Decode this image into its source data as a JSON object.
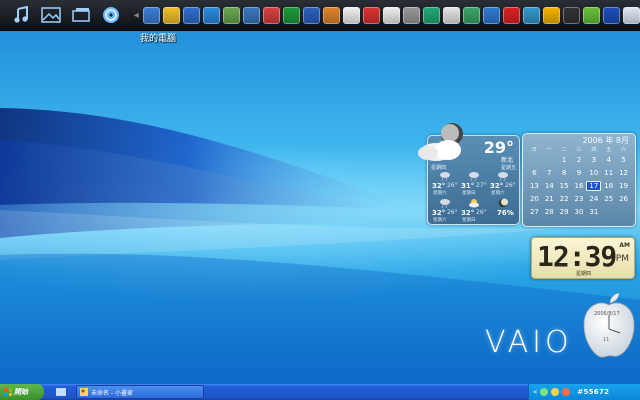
{
  "dock": {
    "label": "我的電腦",
    "big_icons": [
      "music-note-icon",
      "picture-icon",
      "window-icon",
      "disc-icon"
    ],
    "app_icon_colors": [
      "#3b7fd8",
      "#f2c02b",
      "#2f6fd0",
      "#2c8be0",
      "#6aa84f",
      "#3a78c0",
      "#d84141",
      "#1d9a3b",
      "#2c62c2",
      "#e0842c",
      "#f2f2f2",
      "#d33",
      "#efefef",
      "#999",
      "#2a7",
      "#e6e6e6",
      "#3aa66a",
      "#2e7bd6",
      "#d22",
      "#39c",
      "#f7b500",
      "#333",
      "#67c23a",
      "#1d4fbd",
      "#dfe8f5"
    ]
  },
  "weather": {
    "temp": "29°",
    "city": "新北",
    "days": [
      "星期四",
      "星期五"
    ],
    "cells": [
      {
        "hi": "32°",
        "lo": "26°",
        "name": "星期六"
      },
      {
        "hi": "31°",
        "lo": "27°",
        "name": "星期日"
      },
      {
        "hi": "32°",
        "lo": "26°",
        "name": "星期六"
      },
      {
        "hi": "32°",
        "lo": "26°",
        "name": "星期六"
      },
      {
        "hi": "32°",
        "lo": "26°",
        "name": "星期日"
      },
      {
        "hi": "76%",
        "lo": "",
        "name": ""
      }
    ]
  },
  "calendar": {
    "header": "2006 年 8月",
    "weekdays": [
      "日",
      "一",
      "二",
      "三",
      "四",
      "五",
      "六"
    ],
    "days": [
      "",
      "",
      "1",
      "2",
      "3",
      "4",
      "5",
      "6",
      "7",
      "8",
      "9",
      "10",
      "11",
      "12",
      "13",
      "14",
      "15",
      "16",
      "17",
      "18",
      "19",
      "20",
      "21",
      "22",
      "23",
      "24",
      "25",
      "26",
      "27",
      "28",
      "29",
      "30",
      "31",
      "",
      ""
    ],
    "today": "17"
  },
  "clock": {
    "time": "12:39",
    "ampm": "AM",
    "seg": "PM",
    "weekday": "星期四"
  },
  "logo": {
    "text": "VAIO"
  },
  "apple_clock": {
    "date": "2006/8/17",
    "num": "11"
  },
  "taskbar": {
    "start_label": "開始",
    "task_label": "未命名 - 小畫家",
    "tray_label": "#55672"
  }
}
